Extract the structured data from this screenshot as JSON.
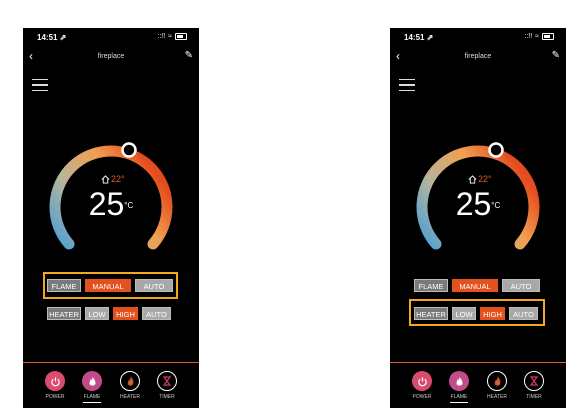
{
  "status": {
    "time": "14:51 ⇗",
    "signal": "::!!",
    "wifi": "≈"
  },
  "nav": {
    "back": "‹",
    "title": "fireplace",
    "edit": "✎"
  },
  "thermostat": {
    "set_temperature": "22°",
    "current_temperature": "25",
    "unit": "°C"
  },
  "flame_row": {
    "label": "FLAME",
    "options": [
      "MANUAL",
      "AUTO"
    ],
    "selected": "MANUAL"
  },
  "heater_row": {
    "label": "HEATER",
    "options": [
      "LOW",
      "HIGH",
      "AUTO"
    ],
    "selected": "HIGH"
  },
  "tabs": [
    "POWER",
    "FLAME",
    "HEATER",
    "TIMER"
  ],
  "colors": {
    "accent": "#e3511e",
    "highlight": "#f2a81d",
    "power": "#d94c6e",
    "flame": "#c24c8a",
    "heater": "#e3511e",
    "timer": "#cc3d66"
  },
  "screens": [
    {
      "id": "left",
      "highlight": "flame_row",
      "active_tab": "FLAME"
    },
    {
      "id": "right",
      "highlight": "heater_row",
      "active_tab": "FLAME"
    }
  ]
}
